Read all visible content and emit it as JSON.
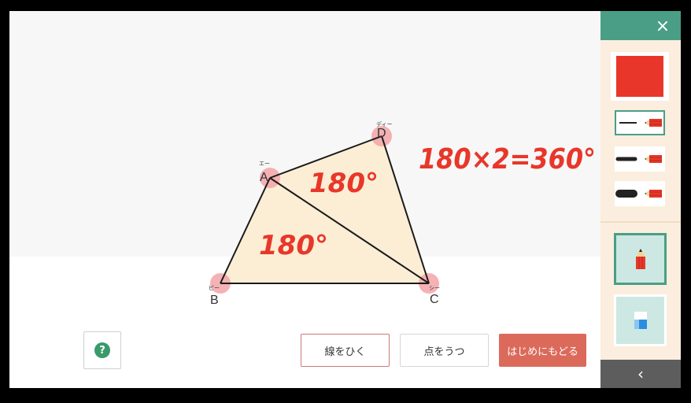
{
  "geometry_canvas": {
    "points": [
      {
        "label": "A",
        "ruby": "エー"
      },
      {
        "label": "B",
        "ruby": "ビー"
      },
      {
        "label": "C",
        "ruby": "シー"
      },
      {
        "label": "D",
        "ruby": "ディー"
      }
    ],
    "handwriting": {
      "angle_upper": "180°",
      "angle_lower": "180°",
      "equation": "180×2=360°"
    }
  },
  "buttons": {
    "help_label": "?",
    "draw_line_label": "線をひく",
    "place_point_label": "点をうつ",
    "reset_label": "はじめにもどる"
  },
  "tool_panel": {
    "close_label": "×",
    "collapse_label": "‹",
    "current_color": "#e8372a",
    "pen_sizes": [
      "thin",
      "medium",
      "thick"
    ],
    "selected_pen": "thin",
    "tools": [
      "pencil-icon",
      "eraser-icon"
    ],
    "selected_tool": "pencil"
  },
  "colors": {
    "accent": "#4a9e86",
    "triangle_fill": "#fbeed5",
    "handwriting": "#e8372a",
    "vertex_highlight": "#f2a4a8",
    "reset_button": "#db6a5b"
  }
}
